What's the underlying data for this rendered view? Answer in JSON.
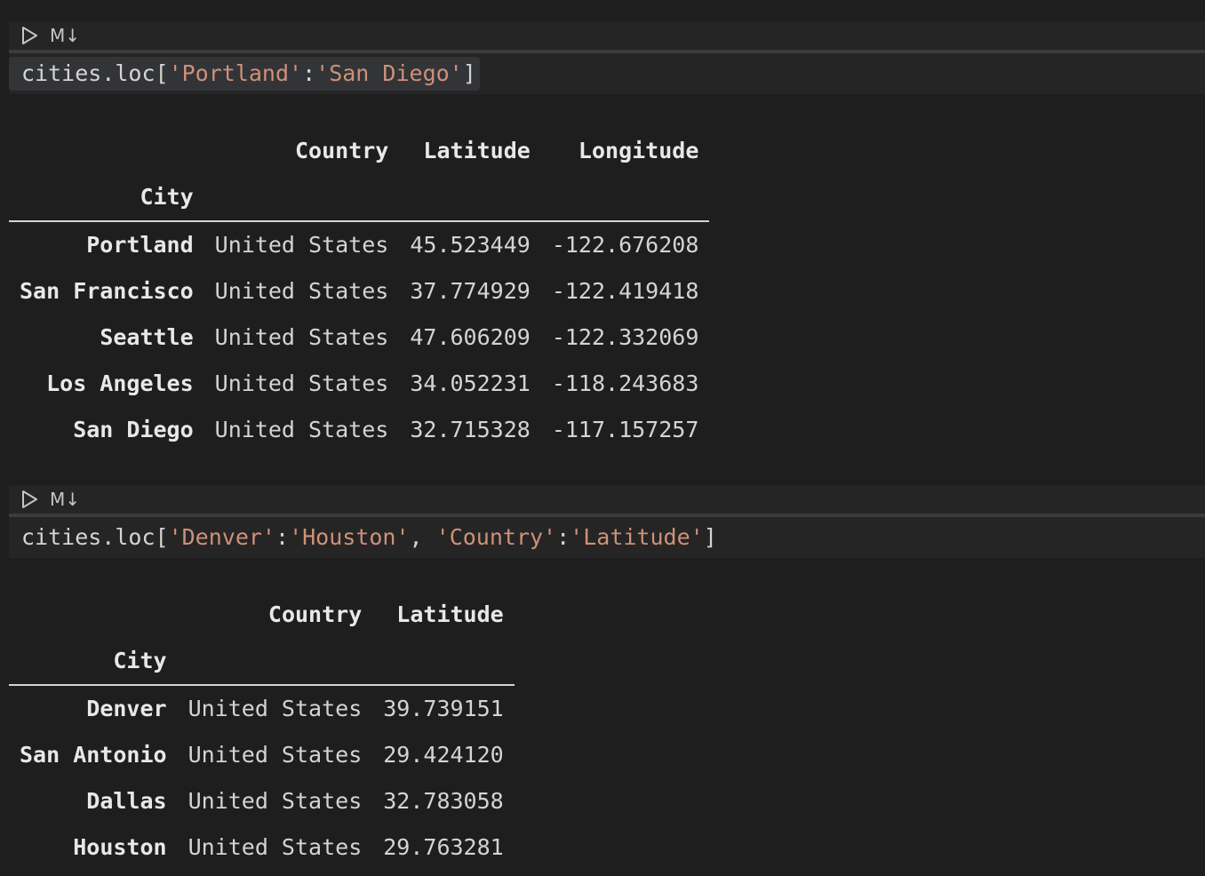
{
  "cells": [
    {
      "toolbar": {
        "md_label": "M↓"
      },
      "code": {
        "prefix": "cities.loc[",
        "tokens": [
          "'Portland'",
          ":",
          "'San Diego'"
        ],
        "suffix": "]"
      },
      "output": {
        "columns": [
          "Country",
          "Latitude",
          "Longitude"
        ],
        "index_name": "City",
        "rows": [
          {
            "index": "Portland",
            "values": [
              "United States",
              "45.523449",
              "-122.676208"
            ]
          },
          {
            "index": "San Francisco",
            "values": [
              "United States",
              "37.774929",
              "-122.419418"
            ]
          },
          {
            "index": "Seattle",
            "values": [
              "United States",
              "47.606209",
              "-122.332069"
            ]
          },
          {
            "index": "Los Angeles",
            "values": [
              "United States",
              "34.052231",
              "-118.243683"
            ]
          },
          {
            "index": "San Diego",
            "values": [
              "United States",
              "32.715328",
              "-117.157257"
            ]
          }
        ]
      }
    },
    {
      "toolbar": {
        "md_label": "M↓"
      },
      "code": {
        "prefix": "cities.loc[",
        "tokens": [
          "'Denver'",
          ":",
          "'Houston'",
          ", ",
          "'Country'",
          ":",
          "'Latitude'"
        ],
        "suffix": "]"
      },
      "output": {
        "columns": [
          "Country",
          "Latitude"
        ],
        "index_name": "City",
        "rows": [
          {
            "index": "Denver",
            "values": [
              "United States",
              "39.739151"
            ]
          },
          {
            "index": "San Antonio",
            "values": [
              "United States",
              "29.424120"
            ]
          },
          {
            "index": "Dallas",
            "values": [
              "United States",
              "32.783058"
            ]
          },
          {
            "index": "Houston",
            "values": [
              "United States",
              "29.763281"
            ]
          }
        ]
      }
    }
  ]
}
